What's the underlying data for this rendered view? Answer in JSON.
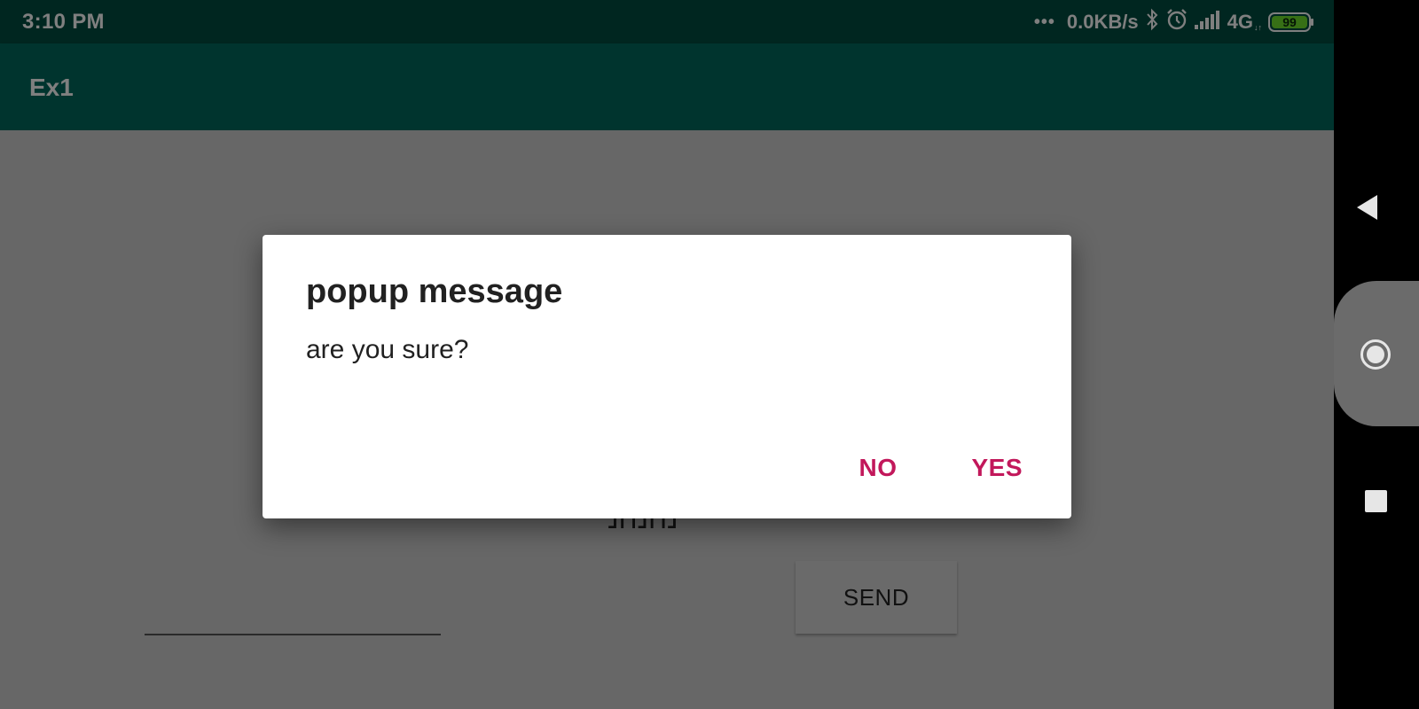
{
  "status_bar": {
    "time": "3:10 PM",
    "more_indicator": "•••",
    "net_speed": "0.0KB/s",
    "bluetooth_icon": "bluetooth-icon",
    "alarm_icon": "alarm-icon",
    "signal_icon": "signal-bars-icon",
    "network_type": "4G",
    "network_sub": "↓↑",
    "battery_level": "99",
    "battery_color": "#6ee02c"
  },
  "app_bar": {
    "title": "Ex1",
    "color": "#00695c"
  },
  "content": {
    "hebrew_label": "נחנחנ",
    "send_label": "SEND",
    "input_value": ""
  },
  "dialog": {
    "title": "popup message",
    "message": "are you sure?",
    "negative_label": "NO",
    "positive_label": "YES",
    "accent_color": "#c2185b"
  },
  "nav_bar": {
    "back_icon": "back-triangle-icon",
    "home_icon": "home-circle-icon",
    "recents_icon": "recents-square-icon"
  }
}
